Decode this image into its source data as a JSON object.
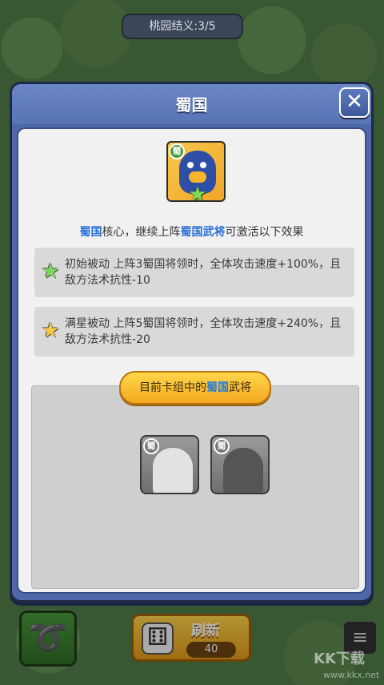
{
  "top_badge": "桃园结义:3/5",
  "modal": {
    "title": "蜀国",
    "close_symbol": "✕",
    "kingdom_tag": "蜀",
    "description": {
      "part1": "蜀国",
      "part2": "核心，继续上阵",
      "part3": "蜀国武将",
      "part4": "可激活以下效果"
    },
    "effects": [
      {
        "star_color": "#7fd85a",
        "text": "初始被动 上阵3蜀国将领时，全体攻击速度+100%，且敌方法术抗性-10"
      },
      {
        "star_color": "#f5c842",
        "text": "满星被动 上阵5蜀国将领时，全体攻击速度+240%，且敌方法术抗性-20"
      }
    ],
    "deck_banner": {
      "part1": "目前卡组中的",
      "part2": "蜀国",
      "part3": "武将"
    },
    "cards": [
      {
        "tag": "蜀"
      },
      {
        "tag": "蜀"
      }
    ]
  },
  "bottom": {
    "left_icon": "rope-icon",
    "refresh_label": "刷新",
    "refresh_cost": "40",
    "menu_icon": "≡"
  },
  "watermark": {
    "text": "KK下载",
    "url": "www.kkx.net"
  }
}
